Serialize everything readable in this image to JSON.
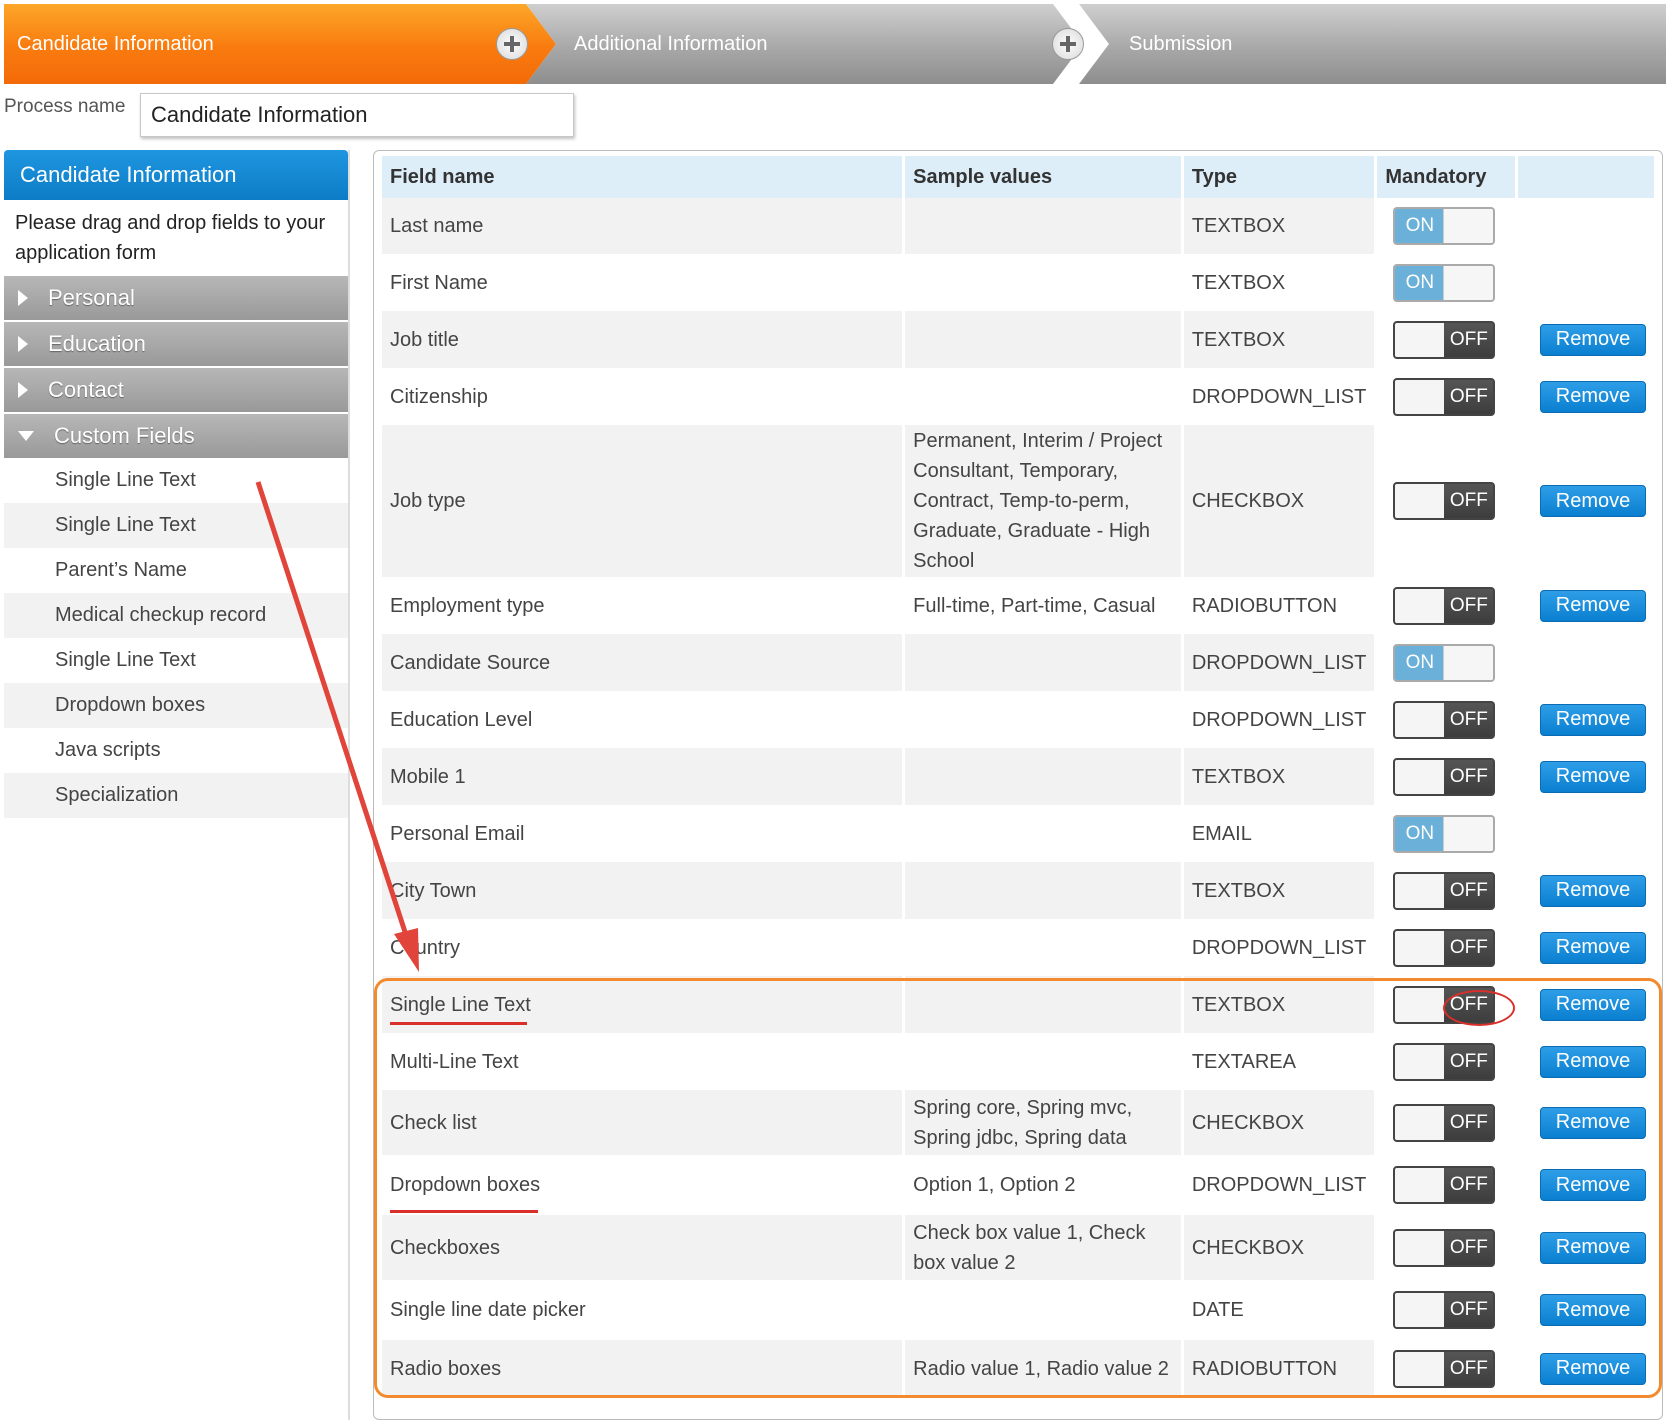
{
  "wizard": {
    "steps": [
      {
        "label": "Candidate Information",
        "active": true
      },
      {
        "label": "Additional Information",
        "active": false
      },
      {
        "label": "Submission",
        "active": false
      }
    ],
    "add_icon": "plus-circle-icon"
  },
  "process": {
    "label": "Process name",
    "value": "Candidate Information"
  },
  "sidebar": {
    "title": "Candidate Information",
    "hint": "Please drag and drop fields to your application form",
    "categories": [
      {
        "label": "Personal",
        "expanded": false
      },
      {
        "label": "Education",
        "expanded": false
      },
      {
        "label": "Contact",
        "expanded": false
      },
      {
        "label": "Custom Fields",
        "expanded": true
      }
    ],
    "custom_fields": [
      "Single Line Text",
      "Single Line Text",
      "Parent’s Name",
      "Medical checkup record",
      "Single Line Text",
      "Dropdown boxes",
      "Java scripts",
      "Specialization"
    ]
  },
  "table": {
    "headers": {
      "field": "Field name",
      "sample": "Sample values",
      "type": "Type",
      "mandatory": "Mandatory"
    },
    "toggle_on": "ON",
    "toggle_off": "OFF",
    "remove_label": "Remove",
    "rows": [
      {
        "field": "Last name",
        "sample": "",
        "type": "TEXTBOX",
        "mandatory": true,
        "removable": false
      },
      {
        "field": "First Name",
        "sample": "",
        "type": "TEXTBOX",
        "mandatory": true,
        "removable": false
      },
      {
        "field": "Job title",
        "sample": "",
        "type": "TEXTBOX",
        "mandatory": false,
        "removable": true
      },
      {
        "field": "Citizenship",
        "sample": "",
        "type": "DROPDOWN_LIST",
        "mandatory": false,
        "removable": true
      },
      {
        "field": "Job type",
        "sample": "Permanent, Interim / Project Consultant, Temporary, Contract, Temp-to-perm, Graduate, Graduate - High School",
        "type": "CHECKBOX",
        "mandatory": false,
        "removable": true
      },
      {
        "field": "Employment type",
        "sample": "Full-time, Part-time, Casual",
        "type": "RADIOBUTTON",
        "mandatory": false,
        "removable": true
      },
      {
        "field": "Candidate Source",
        "sample": "",
        "type": "DROPDOWN_LIST",
        "mandatory": true,
        "removable": false
      },
      {
        "field": "Education Level",
        "sample": "",
        "type": "DROPDOWN_LIST",
        "mandatory": false,
        "removable": true
      },
      {
        "field": "Mobile 1",
        "sample": "",
        "type": "TEXTBOX",
        "mandatory": false,
        "removable": true
      },
      {
        "field": "Personal Email",
        "sample": "",
        "type": "EMAIL",
        "mandatory": true,
        "removable": false
      },
      {
        "field": "City Town",
        "sample": "",
        "type": "TEXTBOX",
        "mandatory": false,
        "removable": true
      },
      {
        "field": "Country",
        "sample": "",
        "type": "DROPDOWN_LIST",
        "mandatory": false,
        "removable": true
      },
      {
        "field": "Single Line Text",
        "sample": "",
        "type": "TEXTBOX",
        "mandatory": false,
        "removable": true
      },
      {
        "field": "Multi-Line Text",
        "sample": "",
        "type": "TEXTAREA",
        "mandatory": false,
        "removable": true
      },
      {
        "field": "Check list",
        "sample": "Spring core, Spring mvc, Spring jdbc, Spring data",
        "type": "CHECKBOX",
        "mandatory": false,
        "removable": true
      },
      {
        "field": "Dropdown boxes",
        "sample": "Option 1, Option 2",
        "type": "DROPDOWN_LIST",
        "mandatory": false,
        "removable": true
      },
      {
        "field": "Checkboxes",
        "sample": "Check box value 1, Check box value 2",
        "type": "CHECKBOX",
        "mandatory": false,
        "removable": true
      },
      {
        "field": "Single line date picker",
        "sample": "",
        "type": "DATE",
        "mandatory": false,
        "removable": true
      },
      {
        "field": "Radio boxes",
        "sample": "Radio value 1, Radio value 2",
        "type": "RADIOBUTTON",
        "mandatory": false,
        "removable": true
      }
    ]
  },
  "colors": {
    "active_step": "#f97b0f",
    "inactive_step": "#a8a8a8",
    "sidebar_header": "#0d7cc6",
    "remove_button": "#0a7fd0",
    "toggle_on": "#6ab0d8",
    "annotation_box": "#f28b2e",
    "annotation_mark": "#d9302b"
  }
}
